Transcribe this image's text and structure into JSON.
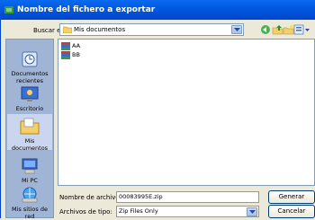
{
  "window": {
    "title": "Nombre del fichero a exportar"
  },
  "toolbar": {
    "look_in_label": "Buscar en:",
    "look_in_value": "Mis documentos",
    "icons": [
      "back-icon",
      "up-folder-icon",
      "new-folder-icon",
      "view-menu-icon"
    ]
  },
  "places": [
    {
      "label": "Documentos recientes",
      "icon": "recent-documents-icon"
    },
    {
      "label": "Escritorio",
      "icon": "desktop-icon"
    },
    {
      "label": "Mis documentos",
      "icon": "my-documents-icon"
    },
    {
      "label": "Mi PC",
      "icon": "my-computer-icon"
    },
    {
      "label": "Mis sitios de red",
      "icon": "network-places-icon"
    }
  ],
  "files": [
    {
      "name": "AA",
      "icon": "archive-icon"
    },
    {
      "name": "BB",
      "icon": "archive-icon"
    }
  ],
  "form": {
    "filename_label": "Nombre de archivo:",
    "filename_value": "00083995E.zip",
    "filetype_label": "Archivos de tipo:",
    "filetype_value": "Zip Files Only"
  },
  "buttons": {
    "save": "Generar",
    "cancel": "Cancelar"
  }
}
